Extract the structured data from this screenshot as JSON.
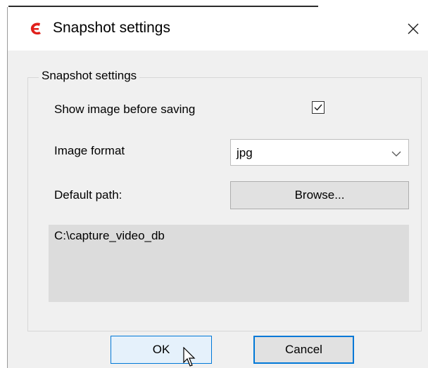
{
  "window": {
    "title": "Snapshot settings",
    "icon": "app-logo-icon",
    "close_icon": "close-icon",
    "accent_color": "#0078d7",
    "brand_color": "#e0201b"
  },
  "group": {
    "legend": "Snapshot settings"
  },
  "show_image": {
    "label": "Show image before saving",
    "checked": true
  },
  "image_format": {
    "label": "Image format",
    "selected": "jpg"
  },
  "default_path": {
    "label": "Default path:",
    "browse_label": "Browse...",
    "value": "C:\\capture_video_db"
  },
  "footer": {
    "ok_label": "OK",
    "cancel_label": "Cancel"
  }
}
